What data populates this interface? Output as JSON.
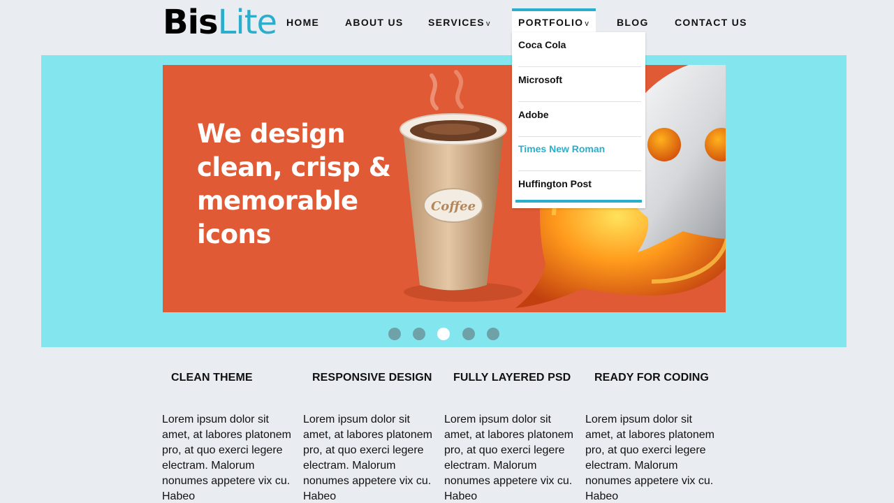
{
  "logo": {
    "part1": "Bis",
    "part2": "Lite"
  },
  "nav": {
    "home": "HOME",
    "about": "ABOUT US",
    "services": "SERVICES",
    "portfolio": "PORTFOLIO",
    "blog": "BLOG",
    "contact": "CONTACT US",
    "caret": "v"
  },
  "dropdown": {
    "items": [
      {
        "label": "Coca Cola"
      },
      {
        "label": "Microsoft"
      },
      {
        "label": "Adobe"
      },
      {
        "label": "Times New Roman",
        "active": true
      },
      {
        "label": "Huffington Post"
      }
    ]
  },
  "slider": {
    "headline": "We design\nclean, crisp &\nmemorable\nicons",
    "cup_label": "Coffee",
    "dots": 5,
    "active_dot": 3
  },
  "features": [
    {
      "title": "CLEAN THEME",
      "text": "Lorem ipsum dolor sit amet, at labores platonem pro, at quo exerci legere electram. Malorum nonumes appetere vix cu. Habeo"
    },
    {
      "title": "RESPONSIVE DESIGN",
      "text": "Lorem ipsum dolor sit amet, at labores platonem pro, at quo exerci legere electram. Malorum nonumes appetere vix cu. Habeo"
    },
    {
      "title": "FULLY LAYERED PSD",
      "text": "Lorem ipsum dolor sit amet, at labores platonem pro, at quo exerci legere electram. Malorum nonumes appetere vix cu. Habeo"
    },
    {
      "title": "READY FOR CODING",
      "text": "Lorem ipsum dolor sit amet, at labores platonem pro, at quo exerci legere electram. Malorum nonumes appetere vix cu. Habeo"
    }
  ],
  "colors": {
    "accent": "#2aaecc",
    "slider_band": "#83e5ed",
    "slide_bg": "#e05a35",
    "page_bg": "#e9ecf1"
  }
}
